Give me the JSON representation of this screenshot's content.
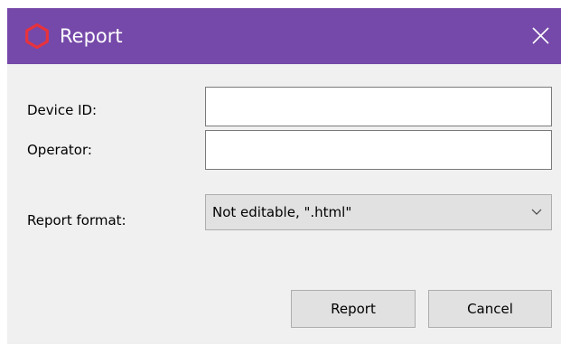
{
  "window": {
    "title": "Report",
    "accent_color": "#7549a9",
    "app_icon": "hexagon-icon",
    "app_icon_color": "#e8323c",
    "close_icon": "close-icon"
  },
  "form": {
    "device_id_label": "Device ID:",
    "device_id_value": "",
    "operator_label": "Operator:",
    "operator_value": "",
    "report_format_label": "Report format:",
    "report_format_selected": "Not editable, \".html\"",
    "dropdown_icon": "chevron-down-icon"
  },
  "buttons": {
    "report_label": "Report",
    "cancel_label": "Cancel"
  }
}
